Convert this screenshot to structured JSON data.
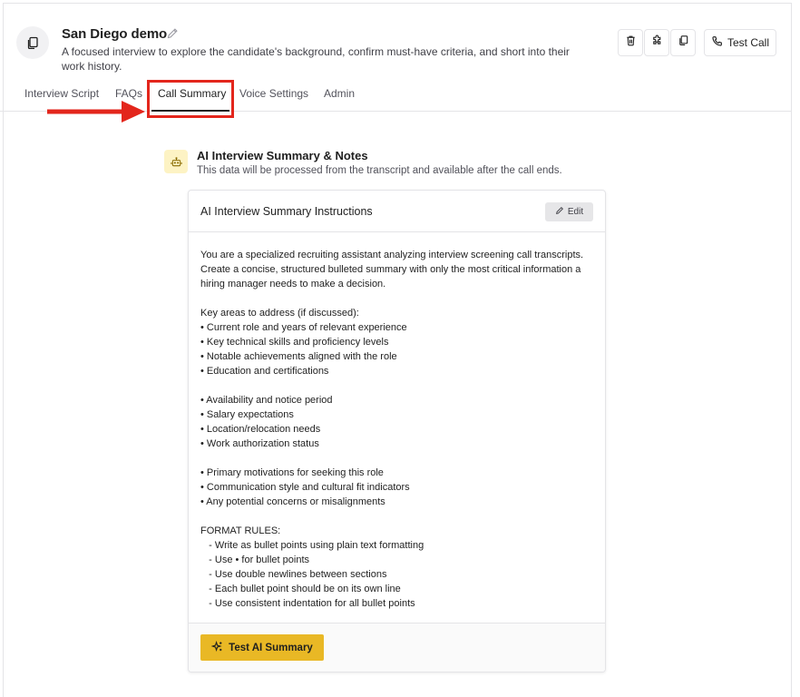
{
  "header": {
    "title": "San Diego demo",
    "description": "A focused interview to explore the candidate's background, confirm must-have criteria, and short into their work history.",
    "test_call_label": "Test Call",
    "icons": [
      "document-copy-icon",
      "pencil-icon",
      "trash-icon",
      "puzzle-icon",
      "copy-icon",
      "phone-icon"
    ]
  },
  "tabs": [
    {
      "label": "Interview Script"
    },
    {
      "label": "FAQs"
    },
    {
      "label": "Call Summary"
    },
    {
      "label": "Voice Settings"
    },
    {
      "label": "Admin"
    }
  ],
  "active_tab": "Call Summary",
  "section": {
    "icon": "robot-icon",
    "title": "AI Interview Summary & Notes",
    "subtitle": "This data will be processed from the transcript and available after the call ends."
  },
  "card": {
    "title": "AI Interview Summary Instructions",
    "edit_label": "Edit",
    "instructions": "You are a specialized recruiting assistant analyzing interview screening call transcripts. Create a concise, structured bulleted summary with only the most critical information a hiring manager needs to make a decision.\n\nKey areas to address (if discussed):\n• Current role and years of relevant experience\n• Key technical skills and proficiency levels\n• Notable achievements aligned with the role\n• Education and certifications\n\n• Availability and notice period\n• Salary expectations\n• Location/relocation needs\n• Work authorization status\n\n• Primary motivations for seeking this role\n• Communication style and cultural fit indicators\n• Any potential concerns or misalignments\n\nFORMAT RULES:\n   - Write as bullet points using plain text formatting\n   - Use • for bullet points\n   - Use double newlines between sections\n   - Each bullet point should be on its own line\n   - Use consistent indentation for all bullet points",
    "test_button_label": "Test AI Summary"
  },
  "colors": {
    "accent": "#e9b825",
    "annotation_red": "#e3261c",
    "section_icon_bg": "#fdf3c4"
  }
}
